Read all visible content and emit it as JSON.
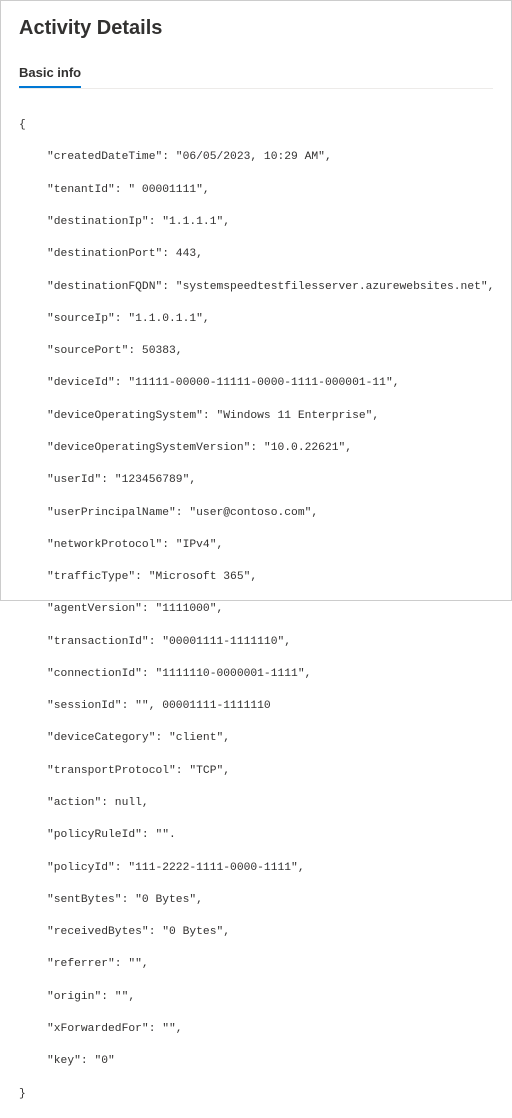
{
  "title": "Activity Details",
  "tabs": {
    "basic_info": "Basic info"
  },
  "json": {
    "open_brace": "{",
    "close_brace": "}",
    "lines": {
      "createdDateTime": "\"createdDateTime\": \"06/05/2023, 10:29 AM\",",
      "tenantId": "\"tenantId\": \" 00001111\",",
      "destinationIp": "\"destinationIp\": \"1.1.1.1\",",
      "destinationPort": "\"destinationPort\": 443,",
      "destinationFQDN": "\"destinationFQDN\": \"systemspeedtestfilesserver.azurewebsites.net\",",
      "sourceIp": "\"sourceIp\": \"1.1.0.1.1\",",
      "sourcePort": "\"sourcePort\": 50383,",
      "deviceId": "\"deviceId\": \"11111-00000-11111-0000-1111-000001-11\",",
      "deviceOperatingSystem": "\"deviceOperatingSystem\": \"Windows 11 Enterprise\",",
      "deviceOperatingSystemVersion": "\"deviceOperatingSystemVersion\": \"10.0.22621\",",
      "userId": "\"userId\": \"123456789\",",
      "userPrincipalName": "\"userPrincipalName\": \"user@contoso.com\",",
      "networkProtocol": "\"networkProtocol\": \"IPv4\",",
      "trafficType": "\"trafficType\": \"Microsoft 365\",",
      "agentVersion": "\"agentVersion\": \"1111000\",",
      "transactionId": "\"transactionId\": \"00001111-1111110\",",
      "connectionId": "\"connectionId\": \"1111110-0000001-1111\",",
      "sessionId": "\"sessionId\": \"\", 00001111-1111110",
      "deviceCategory": "\"deviceCategory\": \"client\",",
      "transportProtocol": "\"transportProtocol\": \"TCP\",",
      "action": "\"action\": null,",
      "policyRuleId": "\"policyRuleId\": \"\".",
      "policyId": "\"policyId\": \"111-2222-1111-0000-1111\",",
      "sentBytes": "\"sentBytes\": \"0 Bytes\",",
      "receivedBytes": "\"receivedBytes\": \"0 Bytes\",",
      "referrer": "\"referrer\": \"\",",
      "origin": "\"origin\": \"\",",
      "xForwardedFor": "\"xForwardedFor\": \"\",",
      "key": "\"key\": \"0\""
    }
  }
}
